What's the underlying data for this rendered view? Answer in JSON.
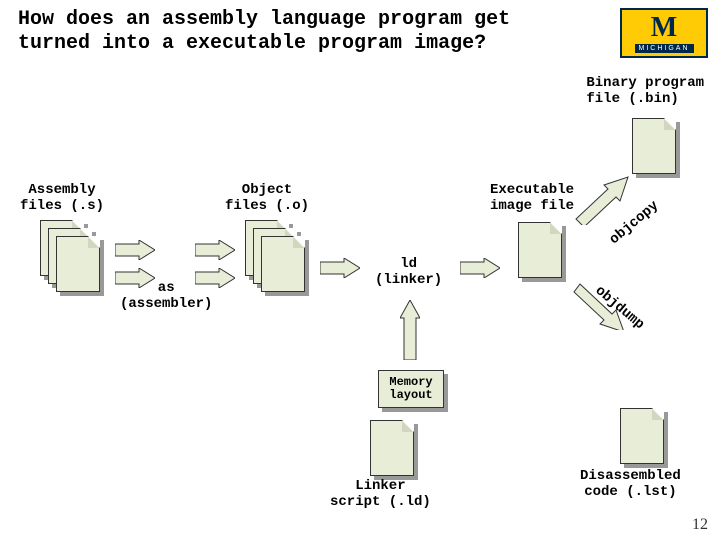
{
  "title": "How does an assembly language program get turned into a executable program image?",
  "logo": {
    "letter": "M",
    "word": "MICHIGAN"
  },
  "labels": {
    "binary": "Binary program\nfile (.bin)",
    "assembly": "Assembly\nfiles (.s)",
    "object": "Object\nfiles (.o)",
    "executable": "Executable\nimage file",
    "assembler": "as\n(assembler)",
    "linker": "ld\n(linker)",
    "memory": "Memory\nlayout",
    "linker_script": "Linker\nscript (.ld)",
    "disassembled": "Disassembled\ncode (.lst)",
    "objcopy": "objcopy",
    "objdump": "objdump"
  },
  "page": "12"
}
